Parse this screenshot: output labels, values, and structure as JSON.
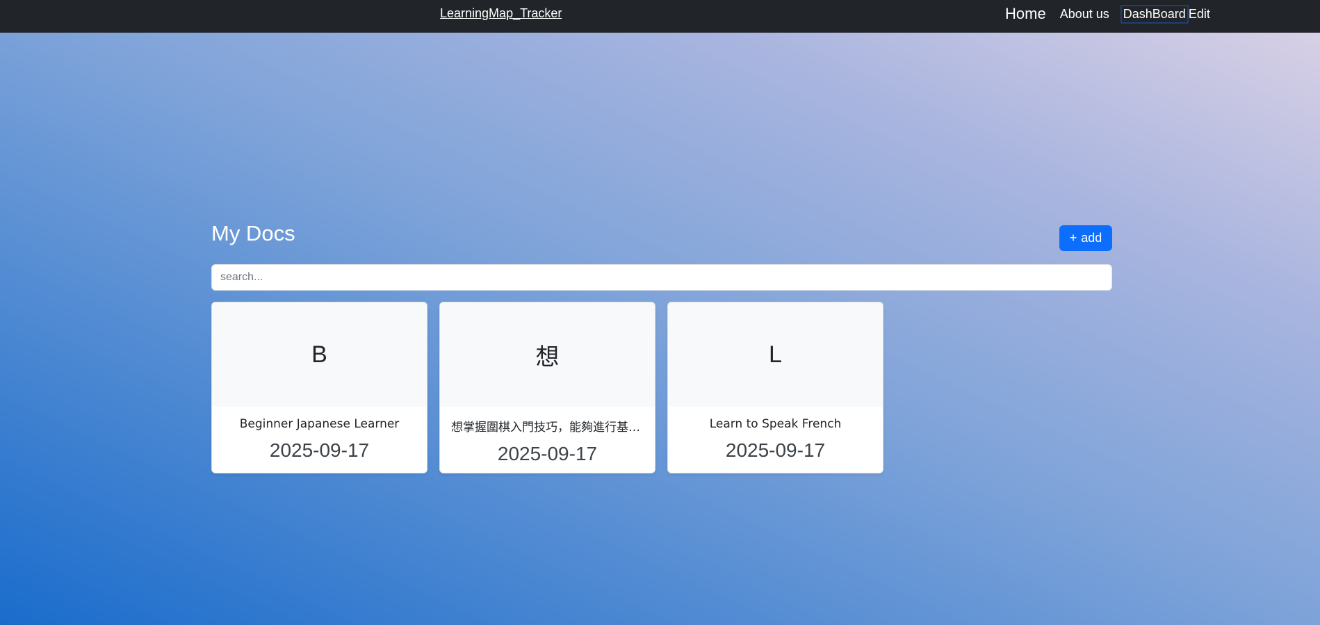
{
  "navbar": {
    "brand": "LearningMap_Tracker",
    "links": {
      "home": "Home",
      "about": "About us",
      "dashboard": "DashBoard",
      "edit": "Edit"
    }
  },
  "main": {
    "title": "My Docs",
    "add_button": {
      "icon": "+",
      "label": "add"
    },
    "search": {
      "placeholder": "search...",
      "value": ""
    },
    "docs": [
      {
        "initial": "B",
        "title": "Beginner Japanese Learner",
        "date": "2025-09-17"
      },
      {
        "initial": "想",
        "title": "想掌握圍棋入門技巧，能夠進行基本對弈",
        "date": "2025-09-17"
      },
      {
        "initial": "L",
        "title": "Learn to Speak French",
        "date": "2025-09-17"
      }
    ]
  },
  "colors": {
    "navbar_bg": "#212529",
    "primary": "#0d6efd",
    "card_thumb_bg": "#f8f9fa",
    "gradient_top_right": "#ddd3e6",
    "gradient_bottom_left": "#1a6ccc"
  }
}
